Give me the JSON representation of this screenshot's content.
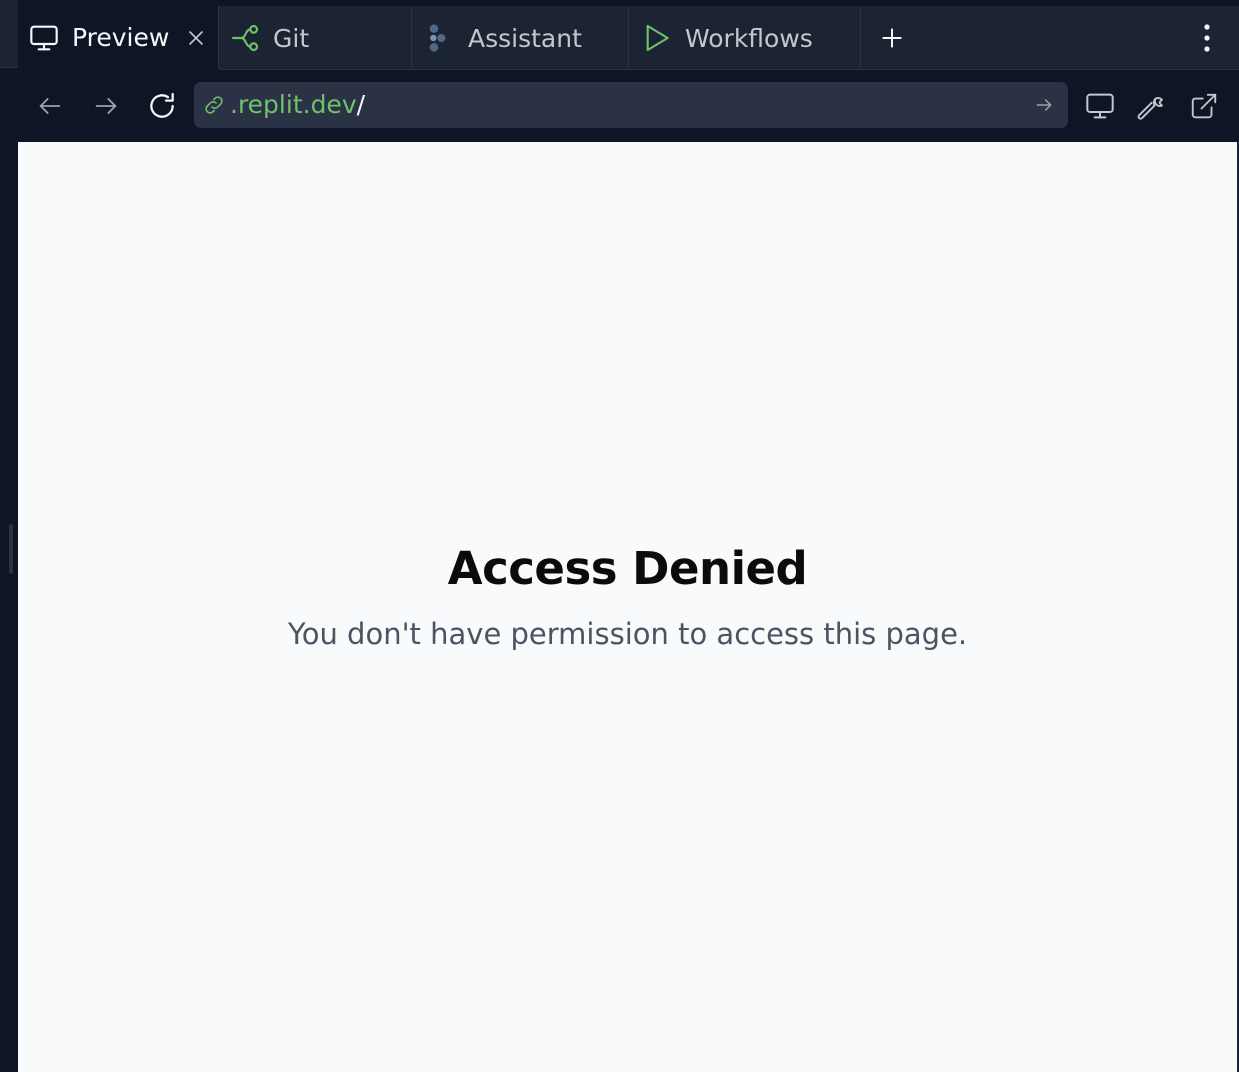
{
  "tabs": [
    {
      "label": "Preview",
      "icon": "monitor-icon",
      "active": true
    },
    {
      "label": "Git",
      "icon": "git-branch-icon",
      "active": false
    },
    {
      "label": "Assistant",
      "icon": "assistant-icon",
      "active": false
    },
    {
      "label": "Workflows",
      "icon": "play-icon",
      "active": false
    }
  ],
  "navbar": {
    "url_host": ".replit.dev",
    "url_path": "/"
  },
  "page": {
    "heading": "Access Denied",
    "message": "You don't have permission to access this page."
  },
  "colors": {
    "chrome_bg": "#1c2333",
    "toolbar_bg": "#0e1525",
    "url_host": "#6fc16a",
    "page_bg": "#f8fafc"
  }
}
